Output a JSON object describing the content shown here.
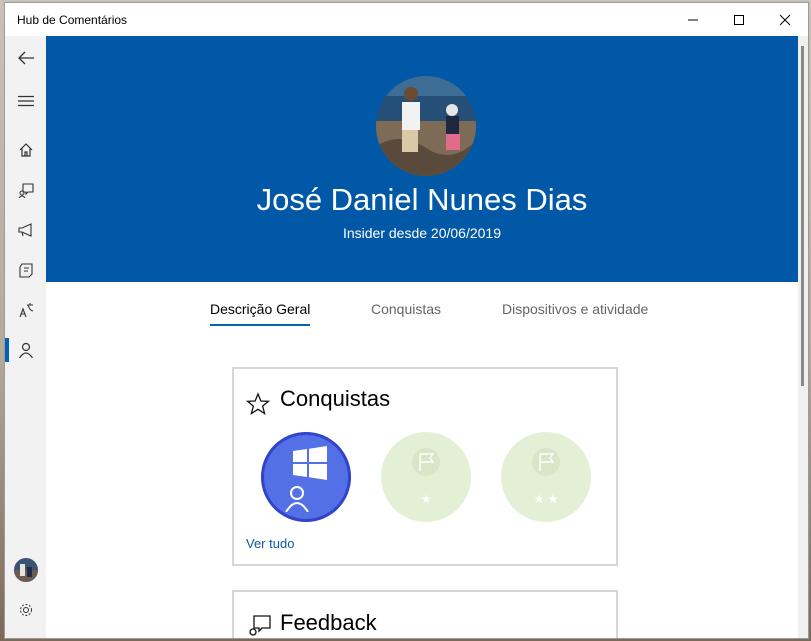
{
  "window": {
    "title": "Hub de Comentários"
  },
  "sidebar": {
    "items": [
      {
        "name": "back-icon"
      },
      {
        "name": "menu-icon"
      },
      {
        "name": "home-icon"
      },
      {
        "name": "feedback-icon"
      },
      {
        "name": "announcements-icon"
      },
      {
        "name": "quests-icon"
      },
      {
        "name": "translate-icon"
      },
      {
        "name": "profile-icon",
        "active": true
      }
    ]
  },
  "profile": {
    "name": "José Daniel Nunes Dias",
    "subtitle": "Insider desde 20/06/2019"
  },
  "tabs": [
    {
      "label": "Descrição Geral",
      "active": true
    },
    {
      "label": "Conquistas"
    },
    {
      "label": "Dispositivos e atividade"
    }
  ],
  "achievements_card": {
    "title": "Conquistas",
    "link": "Ver tudo",
    "badges": [
      {
        "state": "earned",
        "icon": "windows-logo-icon"
      },
      {
        "state": "locked",
        "stars": "★",
        "icon": "flag-icon"
      },
      {
        "state": "locked",
        "stars": "★ ★",
        "icon": "flag-icon"
      }
    ]
  },
  "feedback_card": {
    "title": "Feedback"
  },
  "colors": {
    "accent": "#0063b1",
    "hero": "#0058a6",
    "earned_badge": "#5470e6",
    "locked_badge": "#e3f0d6"
  }
}
